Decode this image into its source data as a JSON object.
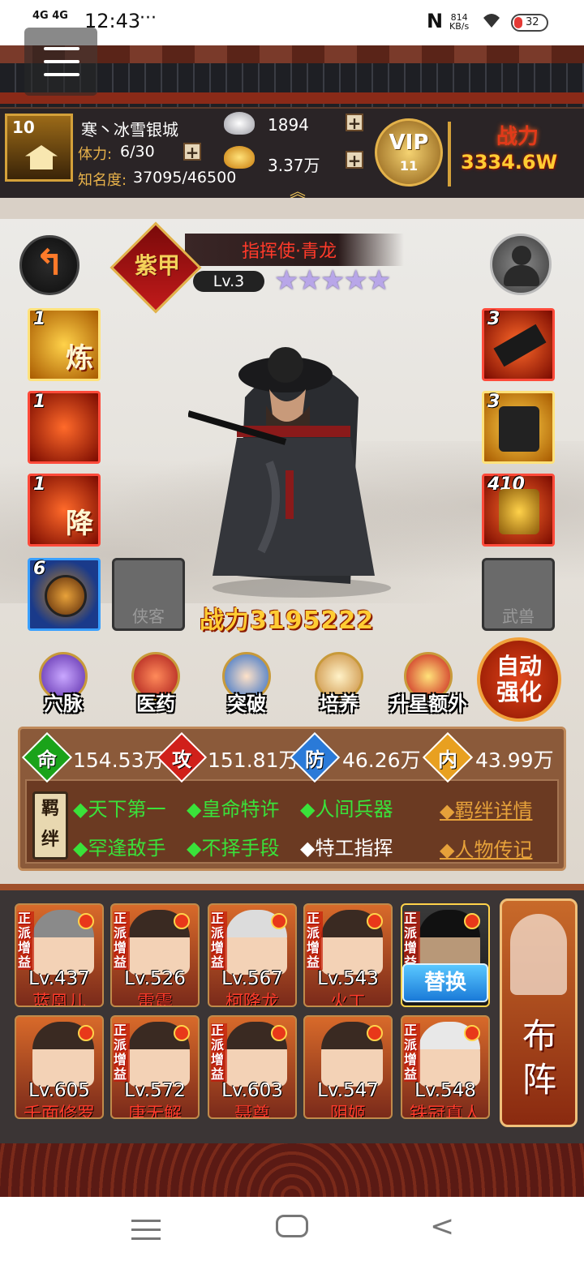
{
  "status_bar": {
    "signal1": "4G",
    "signal2": "4G",
    "time": "12:43",
    "dots": "···",
    "net_speed_value": "814",
    "net_speed_unit": "KB/s",
    "battery": "32"
  },
  "player": {
    "level": "10",
    "name": "寒丶冰雪银城",
    "stamina_label": "体力:",
    "stamina_value": "6/30",
    "fame_label": "知名度:",
    "fame_value": "37095/46500",
    "silver": "1894",
    "gold": "3.37万",
    "vip_label": "VIP",
    "vip_level": "11",
    "power_label": "战力",
    "power_value": "3334.6W"
  },
  "hero": {
    "rank": "紫甲",
    "title": "指挥使·青龙",
    "level": "Lv.3",
    "stars": "★★★★★",
    "power_label": "战力",
    "power_value": "3195222"
  },
  "left_slots": [
    {
      "count": "1",
      "glyph": "炼"
    },
    {
      "count": "1",
      "glyph": ""
    },
    {
      "count": "1",
      "glyph": "降"
    },
    {
      "count": "6",
      "glyph": ""
    }
  ],
  "right_slots": [
    {
      "count": "3"
    },
    {
      "count": "3"
    },
    {
      "count": "410"
    }
  ],
  "empty_slots": {
    "swordsman": "侠客",
    "beast": "武兽"
  },
  "skills": [
    "穴脉",
    "医药",
    "突破",
    "培养",
    "升星额外"
  ],
  "auto_strengthen": [
    "自动",
    "强化"
  ],
  "stats": [
    {
      "icon": "命",
      "value": "154.53万",
      "color": "#1aa31a"
    },
    {
      "icon": "攻",
      "value": "151.81万",
      "color": "#d0201a"
    },
    {
      "icon": "防",
      "value": "46.26万",
      "color": "#2a7ad8"
    },
    {
      "icon": "内",
      "value": "43.99万",
      "color": "#e8a020"
    }
  ],
  "bonds": {
    "tag": [
      "羁",
      "绊"
    ],
    "row1": [
      "◆天下第一",
      "◆皇命特许",
      "◆人间兵器"
    ],
    "row2": [
      "◆罕逢敌手",
      "◆不择手段"
    ],
    "row2_inactive": "◆特工指挥",
    "link_detail": "◆羁绊详情",
    "link_bio": "◆人物传记"
  },
  "team": {
    "card_tag": "正派增益",
    "replace": "替换",
    "formation": "布阵",
    "members": [
      {
        "lv": "Lv.437",
        "name": "蓝凰儿"
      },
      {
        "lv": "Lv.526",
        "name": "雷震"
      },
      {
        "lv": "Lv.567",
        "name": "柯降龙"
      },
      {
        "lv": "Lv.543",
        "name": "火工"
      },
      {
        "lv": "",
        "name": ""
      },
      {
        "lv": "Lv.605",
        "name": "千面修罗"
      },
      {
        "lv": "Lv.572",
        "name": "唐无解"
      },
      {
        "lv": "Lv.603",
        "name": "聂尊"
      },
      {
        "lv": "Lv.547",
        "name": "阴姬"
      },
      {
        "lv": "Lv.548",
        "name": "铁冠真人"
      }
    ]
  }
}
